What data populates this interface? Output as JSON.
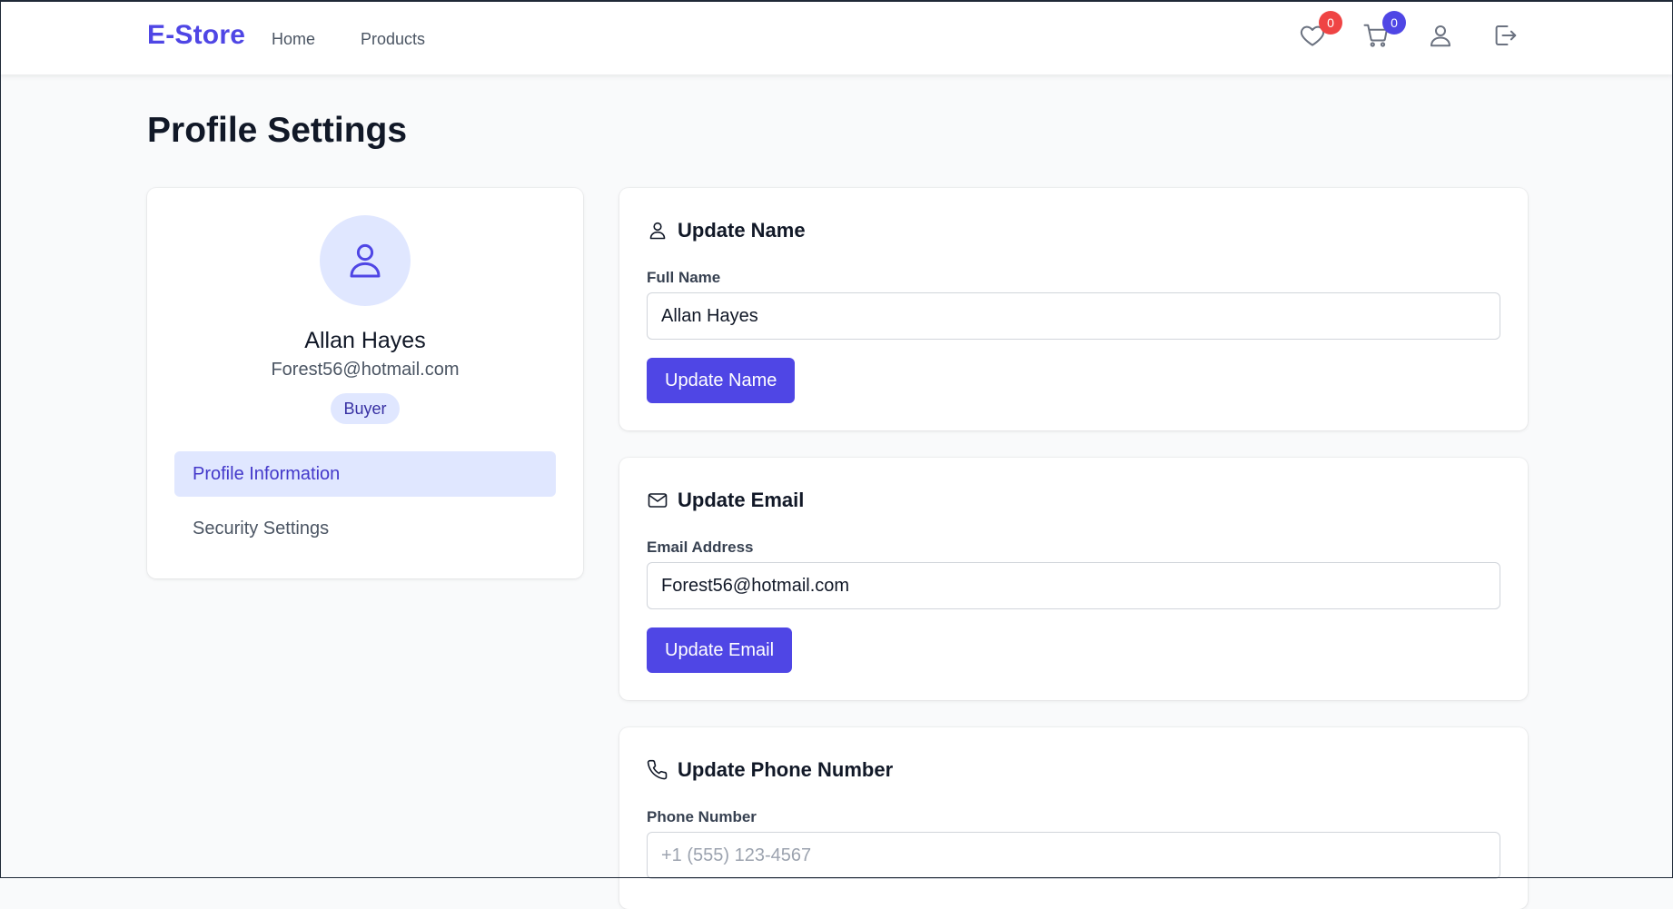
{
  "nav": {
    "brand": "E-Store",
    "links": [
      "Home",
      "Products"
    ],
    "wishlist_count": "0",
    "cart_count": "0",
    "icons": [
      "heart-icon",
      "cart-icon",
      "user-icon",
      "logout-icon"
    ]
  },
  "page": {
    "title": "Profile Settings"
  },
  "profile": {
    "name": "Allan Hayes",
    "email": "Forest56@hotmail.com",
    "role": "Buyer",
    "menu": [
      {
        "label": "Profile Information",
        "active": true
      },
      {
        "label": "Security Settings",
        "active": false
      }
    ]
  },
  "forms": {
    "name": {
      "title": "Update Name",
      "label": "Full Name",
      "value": "Allan Hayes",
      "button": "Update Name"
    },
    "email": {
      "title": "Update Email",
      "label": "Email Address",
      "value": "Forest56@hotmail.com",
      "button": "Update Email"
    },
    "phone": {
      "title": "Update Phone Number",
      "label": "Phone Number",
      "value": "",
      "placeholder": "+1 (555) 123-4567"
    }
  },
  "colors": {
    "brand": "#4f46e5",
    "wishlist_badge": "#ef4444",
    "cart_badge": "#4f46e5",
    "active_bg": "#e0e7ff"
  }
}
